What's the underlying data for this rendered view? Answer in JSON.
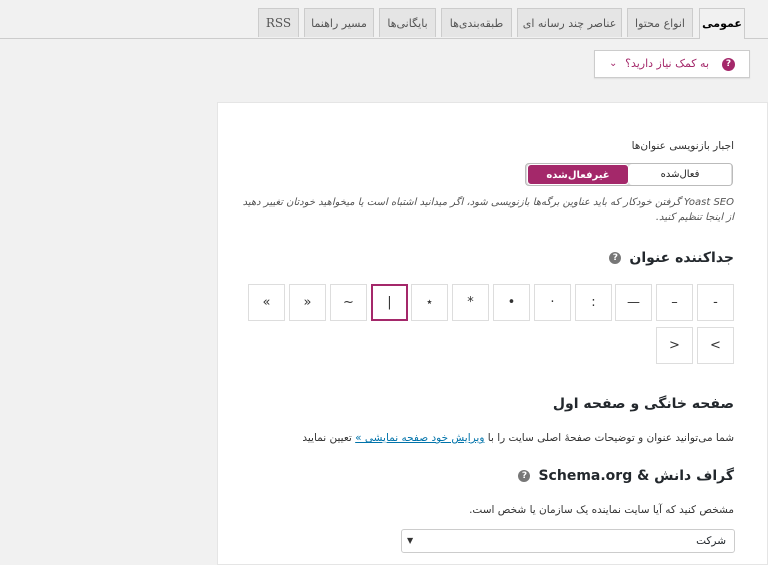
{
  "tabs": [
    {
      "label": "عمومی",
      "active": true
    },
    {
      "label": "انواع محتوا"
    },
    {
      "label": "عناصر چند رسانه ای"
    },
    {
      "label": "طبقه‌بندی‌ها"
    },
    {
      "label": "بایگانی‌ها"
    },
    {
      "label": "مسیر راهنما"
    },
    {
      "label": "RSS"
    }
  ],
  "help": {
    "label": "به کمک نیاز دارید؟",
    "icon": "question-icon",
    "chevron": "⌄"
  },
  "rewrite": {
    "label": "اجبار بازنویسی عنوان‌ها",
    "on_label": "فعال‌شده",
    "off_label": "غیرفعال‌شده",
    "selected": "off",
    "note": "Yoast SEO گرفتن خودکار که باید عناوین برگه‌ها بازنویسی شود، اگر میدانید اشتباه است یا میخواهید خودتان تغییر دهید از اینجا تنظیم کنید."
  },
  "separator": {
    "title": "جداکننده عنوان",
    "options": [
      "-",
      "–",
      "—",
      ":",
      "·",
      "•",
      "*",
      "⋆",
      "|",
      "~",
      "«",
      "»",
      ">",
      "<"
    ],
    "selected": "|"
  },
  "homepage": {
    "title": "صفحه خانگی و صفحه اول",
    "desc_before": "شما می‌توانید عنوان و توضیحات صفحهٔ اصلی سایت را با ",
    "link": "ویرایش خود صفحه نمایشی »",
    "desc_after": " تعیین نمایید"
  },
  "schema": {
    "title": "گراف دانش & Schema.org",
    "desc": "مشخص کنید که آیا سایت نماینده یک سازمان یا شخص است.",
    "select_value": "شرکت"
  },
  "colors": {
    "accent": "#a4286a"
  }
}
